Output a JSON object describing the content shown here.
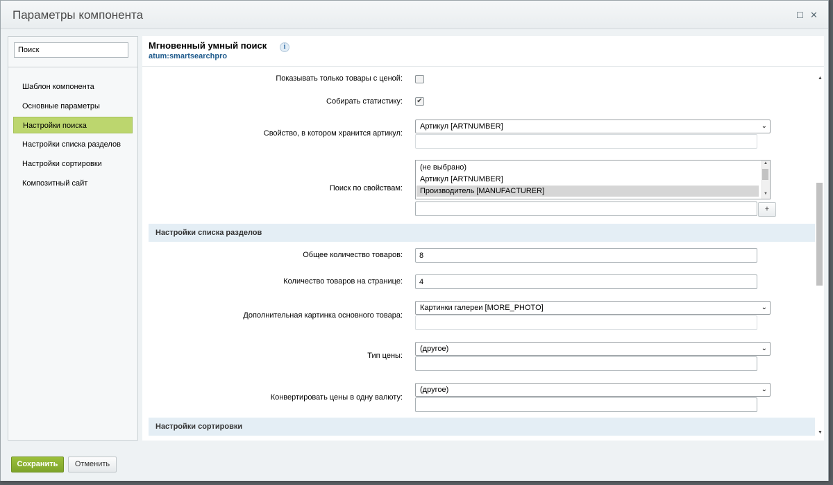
{
  "window": {
    "title": "Параметры компонента"
  },
  "sidebar": {
    "search_placeholder": "Поиск",
    "items": [
      {
        "label": "Шаблон компонента"
      },
      {
        "label": "Основные параметры"
      },
      {
        "label": "Настройки поиска",
        "active": true
      },
      {
        "label": "Настройки списка разделов"
      },
      {
        "label": "Настройки сортировки"
      },
      {
        "label": "Композитный сайт"
      }
    ]
  },
  "component": {
    "title": "Мгновенный умный поиск",
    "code": "atum:smartsearchpro"
  },
  "fields": {
    "show_priced_only": {
      "label": "Показывать только товары с ценой:",
      "checked": false
    },
    "collect_stats": {
      "label": "Собирать статистику:",
      "checked": true
    },
    "article_prop": {
      "label": "Свойство, в котором хранится артикул:",
      "value": "Артикул [ARTNUMBER]",
      "extra_value": ""
    },
    "search_props": {
      "label": "Поиск по свойствам:",
      "options": [
        "(не выбрано)",
        "Артикул [ARTNUMBER]",
        "Производитель [MANUFACTURER]"
      ],
      "selected": "Производитель [MANUFACTURER]",
      "extra_value": "",
      "add_label": "+"
    }
  },
  "sections": {
    "list": "Настройки списка разделов",
    "sort": "Настройки сортировки"
  },
  "list_fields": {
    "total_count": {
      "label": "Общее количество товаров:",
      "value": "8"
    },
    "per_page": {
      "label": "Количество товаров на странице:",
      "value": "4"
    },
    "extra_picture": {
      "label": "Дополнительная картинка основного товара:",
      "value": "Картинки галереи [MORE_PHOTO]",
      "extra_value": ""
    },
    "price_type": {
      "label": "Тип цены:",
      "value": "(другое)",
      "extra_value": ""
    },
    "currency": {
      "label": "Конвертировать цены в одну валюту:",
      "value": "(другое)",
      "extra_value": ""
    }
  },
  "footer": {
    "save_label": "Сохранить",
    "cancel_label": "Отменить"
  },
  "colors": {
    "accent_green": "#8db335",
    "section_bg": "#e4eef5",
    "link_blue": "#1e5a8c"
  }
}
